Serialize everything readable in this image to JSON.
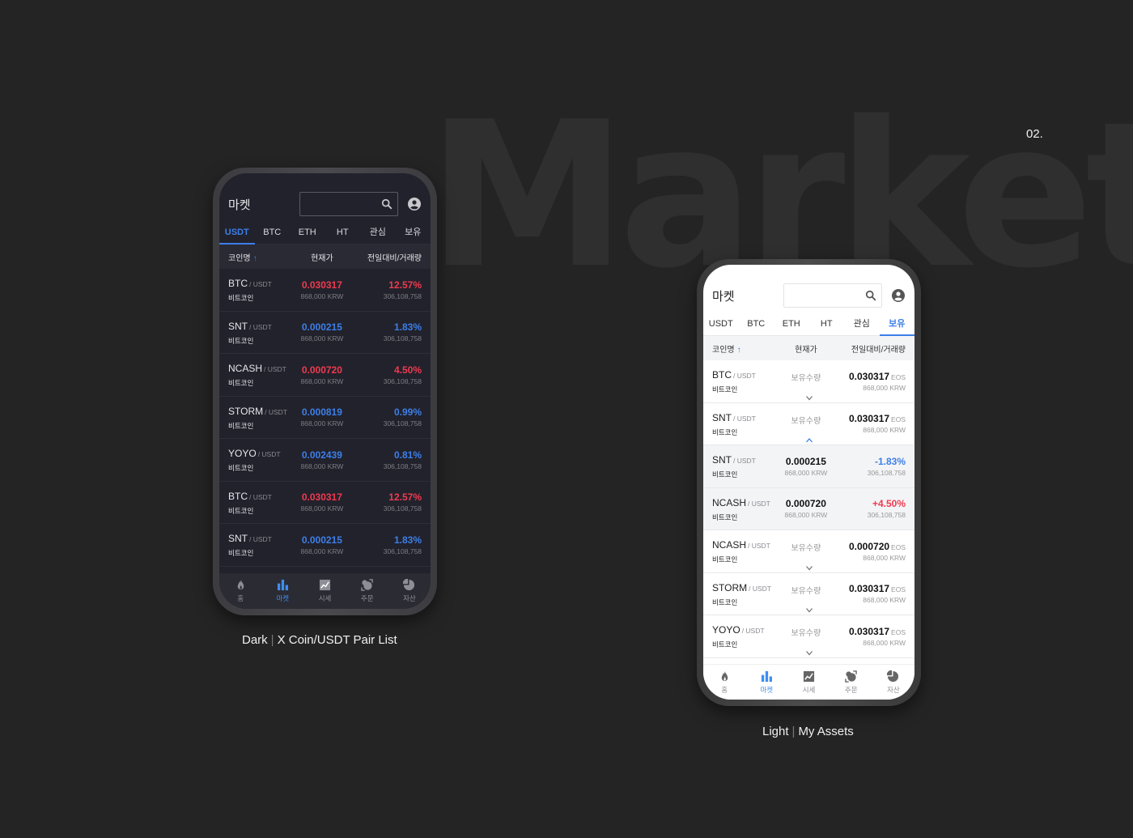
{
  "background_word": "Market",
  "page_number": "02.",
  "dark_phone": {
    "caption": {
      "mode": "Dark",
      "description": "X Coin/USDT Pair List"
    },
    "title": "마켓",
    "search_placeholder": "",
    "tabs": [
      {
        "label": "USDT",
        "active": true
      },
      {
        "label": "BTC",
        "active": false
      },
      {
        "label": "ETH",
        "active": false
      },
      {
        "label": "HT",
        "active": false
      },
      {
        "label": "관심",
        "active": false
      },
      {
        "label": "보유",
        "active": false
      }
    ],
    "columns": {
      "name": "코인명",
      "sort_arrow": "↑",
      "price": "현재가",
      "change": "전일대비/거래량"
    },
    "rows": [
      {
        "symbol": "BTC",
        "quote": "/ USDT",
        "kr_name": "비트코인",
        "price": "0.030317",
        "krw": "868,000 KRW",
        "change": "12.57%",
        "volume": "306,108,758",
        "direction": "up"
      },
      {
        "symbol": "SNT",
        "quote": "/ USDT",
        "kr_name": "비트코인",
        "price": "0.000215",
        "krw": "868,000 KRW",
        "change": "1.83%",
        "volume": "306,108,758",
        "direction": "down"
      },
      {
        "symbol": "NCASH",
        "quote": "/ USDT",
        "kr_name": "비트코인",
        "price": "0.000720",
        "krw": "868,000 KRW",
        "change": "4.50%",
        "volume": "306,108,758",
        "direction": "up"
      },
      {
        "symbol": "STORM",
        "quote": "/ USDT",
        "kr_name": "비트코인",
        "price": "0.000819",
        "krw": "868,000 KRW",
        "change": "0.99%",
        "volume": "306,108,758",
        "direction": "down"
      },
      {
        "symbol": "YOYO",
        "quote": "/ USDT",
        "kr_name": "비트코인",
        "price": "0.002439",
        "krw": "868,000 KRW",
        "change": "0.81%",
        "volume": "306,108,758",
        "direction": "down"
      },
      {
        "symbol": "BTC",
        "quote": "/ USDT",
        "kr_name": "비트코인",
        "price": "0.030317",
        "krw": "868,000 KRW",
        "change": "12.57%",
        "volume": "306,108,758",
        "direction": "up"
      },
      {
        "symbol": "SNT",
        "quote": "/ USDT",
        "kr_name": "비트코인",
        "price": "0.000215",
        "krw": "868,000 KRW",
        "change": "1.83%",
        "volume": "306,108,758",
        "direction": "down"
      }
    ],
    "nav": [
      {
        "label": "홈",
        "icon": "fire-icon",
        "active": false
      },
      {
        "label": "마켓",
        "icon": "bar-chart-icon",
        "active": true
      },
      {
        "label": "시세",
        "icon": "trend-chart-icon",
        "active": false
      },
      {
        "label": "주문",
        "icon": "order-icon",
        "active": false
      },
      {
        "label": "자산",
        "icon": "pie-chart-icon",
        "active": false
      }
    ]
  },
  "light_phone": {
    "caption": {
      "mode": "Light",
      "description": "My Assets"
    },
    "title": "마켓",
    "search_placeholder": "",
    "tabs": [
      {
        "label": "USDT",
        "active": false
      },
      {
        "label": "BTC",
        "active": false
      },
      {
        "label": "ETH",
        "active": false
      },
      {
        "label": "HT",
        "active": false
      },
      {
        "label": "관심",
        "active": false
      },
      {
        "label": "보유",
        "active": true
      }
    ],
    "columns": {
      "name": "코인명",
      "sort_arrow": "↑",
      "price": "현재가",
      "change": "전일대비/거래량"
    },
    "rows": [
      {
        "type": "holding",
        "symbol": "BTC",
        "quote": "/ USDT",
        "kr_name": "비트코인",
        "hold_label": "보유수량",
        "amount": "0.030317",
        "unit": "EOS",
        "krw": "868,000 KRW",
        "expanded": false
      },
      {
        "type": "holding",
        "symbol": "SNT",
        "quote": "/ USDT",
        "kr_name": "비트코인",
        "hold_label": "보유수량",
        "amount": "0.030317",
        "unit": "EOS",
        "krw": "868,000 KRW",
        "expanded": true
      },
      {
        "type": "market",
        "symbol": "SNT",
        "quote": "/ USDT",
        "kr_name": "비트코인",
        "price": "0.000215",
        "krw": "868,000 KRW",
        "change": "-1.83%",
        "volume": "306,108,758",
        "direction": "down"
      },
      {
        "type": "market",
        "symbol": "NCASH",
        "quote": "/ USDT",
        "kr_name": "비트코인",
        "price": "0.000720",
        "krw": "868,000 KRW",
        "change": "+4.50%",
        "volume": "306,108,758",
        "direction": "up"
      },
      {
        "type": "holding",
        "symbol": "NCASH",
        "quote": "/ USDT",
        "kr_name": "비트코인",
        "hold_label": "보유수량",
        "amount": "0.000720",
        "unit": "EOS",
        "krw": "868,000 KRW",
        "expanded": false
      },
      {
        "type": "holding",
        "symbol": "STORM",
        "quote": "/ USDT",
        "kr_name": "비트코인",
        "hold_label": "보유수량",
        "amount": "0.030317",
        "unit": "EOS",
        "krw": "868,000 KRW",
        "expanded": false
      },
      {
        "type": "holding",
        "symbol": "YOYO",
        "quote": "/ USDT",
        "kr_name": "비트코인",
        "hold_label": "보유수량",
        "amount": "0.030317",
        "unit": "EOS",
        "krw": "868,000 KRW",
        "expanded": false
      }
    ],
    "nav": [
      {
        "label": "홈",
        "icon": "fire-icon",
        "active": false
      },
      {
        "label": "마켓",
        "icon": "bar-chart-icon",
        "active": true
      },
      {
        "label": "시세",
        "icon": "trend-chart-icon",
        "active": false
      },
      {
        "label": "주문",
        "icon": "order-icon",
        "active": false
      },
      {
        "label": "자산",
        "icon": "pie-chart-icon",
        "active": false
      }
    ]
  },
  "colors": {
    "accent": "#3d7fe8",
    "up": "#ef3a4f",
    "down": "#3d7fe8",
    "background": "#242424"
  }
}
